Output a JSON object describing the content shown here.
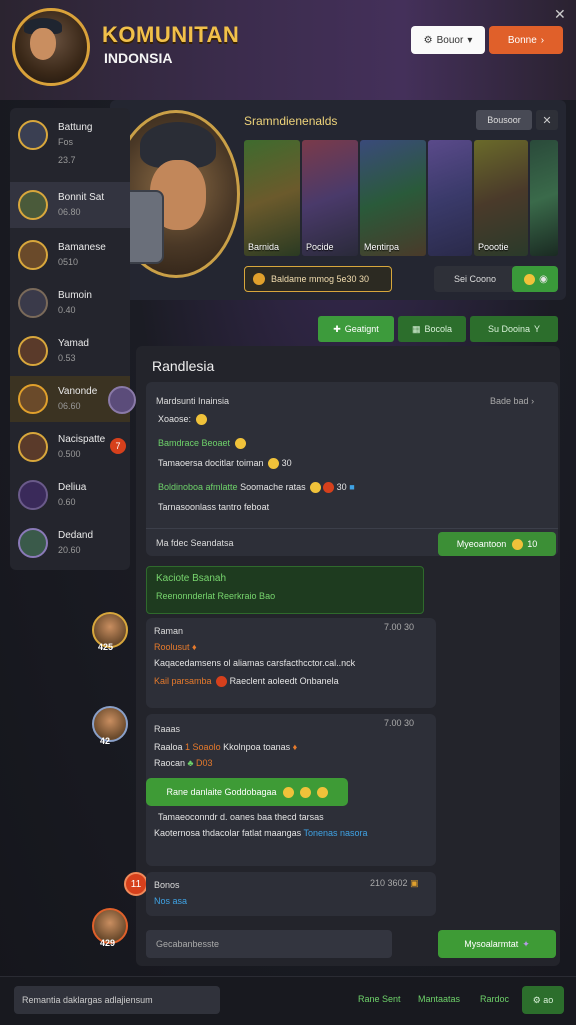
{
  "header": {
    "title_line1": "KOMUNITAN",
    "title_line2": "INDONSIA",
    "btn_white_label": "Bouor",
    "btn_orange_label": "Bonne",
    "close": "✕"
  },
  "sidebar": {
    "items": [
      {
        "name": "Battung",
        "sub": "Fos"
      },
      {
        "name": "",
        "sub": "23.7"
      },
      {
        "name": "Bonnit Sat",
        "sub": "06.80"
      },
      {
        "name": "Bamanese",
        "sub": "0510"
      },
      {
        "name": "Bumoin",
        "sub": "0.40"
      },
      {
        "name": "Yamad",
        "sub": "0.53"
      },
      {
        "name": "Vanonde",
        "sub": "06.60"
      },
      {
        "name": "Nacispatte",
        "sub": "0.500"
      },
      {
        "name": "Deliua",
        "sub": "0.60"
      },
      {
        "name": "Dedand",
        "sub": "20.60"
      }
    ],
    "notif": "7"
  },
  "gallery": {
    "title": "Sramndienenalds",
    "btn_label": "Bousoor",
    "btn_close": "✕",
    "cards": [
      "Barnida",
      "Pocide",
      "Mentirpa",
      "",
      "Poootie",
      ""
    ],
    "search_text": "Baldame mmog 5e30 30",
    "right_pill": "Sei Coono"
  },
  "tabs": {
    "main": "Geatignt",
    "second": "Bocola",
    "third": "Su Dooina",
    "third_icon": "Y"
  },
  "main": {
    "title": "Randlesia",
    "box1": {
      "head": "Mardsunti Inainsia",
      "right": "Bade bad",
      "line1": "Xoaose:",
      "line2": "Bamdrace Beoaet",
      "line3_w": "Tamaoersa docitlar toiman",
      "line3_num": "30",
      "line4_g": "Boldinoboa afmlatte",
      "line4_w": "Soomache ratas",
      "line4_num": "30",
      "line5": "Tarnasoonlass tantro feboat",
      "foot": "Ma fdec Seandatsa",
      "green_btn": "Myeoantoon",
      "green_num": "10"
    },
    "gbox": {
      "t1": "Kaciote Bsanah",
      "t2": "Reenonnderlat Reerkraio Bao"
    },
    "msg1": {
      "lvl": "425",
      "name": "Raman",
      "time": "7.00 30",
      "line1": "Roolusut",
      "line2": "Kaqacedamsens ol aliamas carsfacthcctor.cal..nck",
      "line3a": "Kail parsamba",
      "line3b": "Raeclent aoleedt Onbanela"
    },
    "msg2": {
      "lvl": "42",
      "name": "Raaas",
      "time": "7.00 30",
      "line1a": "Raaloa",
      "line1b": "1 Soaolo",
      "line1c": "Kkolnpoa toanas",
      "line2": "Raocan",
      "line2num": "D03",
      "bubble": "Rane danlaite Goddobagaa",
      "line3": "Tamaeoconndr d. oanes baa thecd tarsas",
      "line4a": "Kaoternosa thdacolar fatlat maangas",
      "line4b": "Tonenas",
      "line4c": "nasora"
    },
    "msg3": {
      "badge": "11",
      "name": "Bonos",
      "time": "210 3602",
      "line1": "Nos asa"
    },
    "msg4_lvl": "429",
    "input_placeholder": "Gecabanbesste",
    "send_label": "Mysoalarmtat"
  },
  "footer": {
    "input_text": "Remantia daklargas adlajiensum",
    "link1": "Rane Sent",
    "link2": "Mantaatas",
    "link3": "Rardoc",
    "btn": "ao"
  },
  "colors": {
    "accent_green": "#3e9b36",
    "accent_orange": "#e0602a",
    "gold": "#d8a73c"
  }
}
